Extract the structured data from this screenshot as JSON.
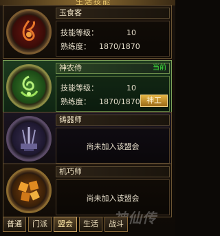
{
  "header": {
    "title": "生活技能"
  },
  "skills": [
    {
      "name": "玉食客",
      "icon": "spoon-flame-emblem-icon",
      "level_label": "技能等级：",
      "level_value": "10",
      "proficiency_label": "熟练度：",
      "proficiency_value": "1870/1870"
    },
    {
      "name": "神农侍",
      "icon": "herb-swirl-emblem-icon",
      "status": "当前",
      "level_label": "技能等级：",
      "level_value": "10",
      "proficiency_label": "熟练度：",
      "proficiency_value": "1870/1870",
      "action_label": "神工"
    },
    {
      "name": "铸器师",
      "icon": "forge-weapons-emblem-icon",
      "not_joined_text": "尚未加入该盟会"
    },
    {
      "name": "机巧师",
      "icon": "gear-mechanism-emblem-icon",
      "not_joined_text": "尚未加入该盟会"
    }
  ],
  "tabs": [
    {
      "label": "普通"
    },
    {
      "label": "门派"
    },
    {
      "label": "盟会"
    },
    {
      "label": "生活"
    },
    {
      "label": "战斗"
    }
  ],
  "active_tab": "盟会",
  "watermark": "神仙传",
  "colors": {
    "current_status": "#3de23d",
    "action_button": "#e6b443",
    "active_card_border": "#7fa35a"
  }
}
